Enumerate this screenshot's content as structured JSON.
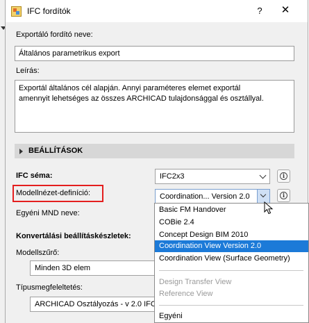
{
  "window": {
    "title": "IFC fordítók",
    "help_label": "?",
    "close_label": "✕"
  },
  "translator": {
    "name_label": "Exportáló fordító neve:",
    "name_value": "Általános parametrikus export",
    "description_label": "Leírás:",
    "description_line1": "Exportál általános cél alapján. Annyi paraméteres elemet exportál",
    "description_line2": "amennyit lehetséges az összes ARCHICAD tulajdonsággal és osztállyal."
  },
  "settings": {
    "section_title": "BEÁLLÍTÁSOK",
    "ifc_schema_label": "IFC séma:",
    "ifc_schema_value": "IFC2x3",
    "mvd_label": "Modellnézet-definíció:",
    "mvd_value": "Coordination... Version 2.0",
    "custom_mvd_label": "Egyéni MND neve:",
    "conversion_label": "Konvertálási beállításkészletek:",
    "model_filter_label": "Modellszűrő:",
    "model_filter_value": "Minden 3D elem",
    "type_mapping_label": "Típusmegfeleltetés:",
    "type_mapping_value": "ARCHICAD Osztályozás - v 2.0 IFC2"
  },
  "dropdown": {
    "items": [
      {
        "label": "Basic FM Handover",
        "state": "normal"
      },
      {
        "label": "COBie 2.4",
        "state": "normal"
      },
      {
        "label": "Concept Design BIM 2010",
        "state": "normal"
      },
      {
        "label": "Coordination View Version 2.0",
        "state": "selected"
      },
      {
        "label": "Coordination View (Surface Geometry)",
        "state": "normal"
      },
      {
        "label": "Design Transfer View",
        "state": "disabled"
      },
      {
        "label": "Reference View",
        "state": "disabled"
      },
      {
        "label": "Egyéni",
        "state": "normal"
      }
    ]
  },
  "colors": {
    "selection": "#1c7ad8",
    "highlight_frame": "#e41e1e",
    "section_bar": "#d7d7d7"
  }
}
